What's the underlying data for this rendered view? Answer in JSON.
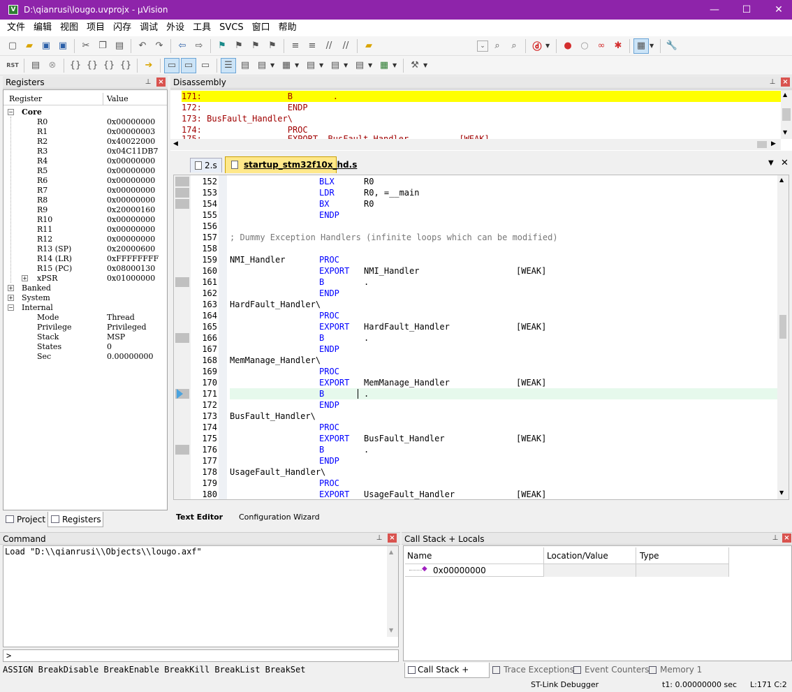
{
  "window": {
    "title": "D:\\qianrusi\\lougo.uvprojx - µVision",
    "minimize": "—",
    "maximize": "☐",
    "close": "✕"
  },
  "menu": [
    "文件",
    "编辑",
    "视图",
    "项目",
    "闪存",
    "调试",
    "外设",
    "工具",
    "SVCS",
    "窗口",
    "帮助"
  ],
  "registers": {
    "title": "Registers",
    "col_register": "Register",
    "col_value": "Value",
    "groups": {
      "core": "Core",
      "banked": "Banked",
      "system": "System",
      "internal": "Internal"
    },
    "core": [
      {
        "name": "R0",
        "value": "0x00000000"
      },
      {
        "name": "R1",
        "value": "0x00000003"
      },
      {
        "name": "R2",
        "value": "0x40022000"
      },
      {
        "name": "R3",
        "value": "0x04C11DB7"
      },
      {
        "name": "R4",
        "value": "0x00000000"
      },
      {
        "name": "R5",
        "value": "0x00000000"
      },
      {
        "name": "R6",
        "value": "0x00000000"
      },
      {
        "name": "R7",
        "value": "0x00000000"
      },
      {
        "name": "R8",
        "value": "0x00000000"
      },
      {
        "name": "R9",
        "value": "0x20000160"
      },
      {
        "name": "R10",
        "value": "0x00000000"
      },
      {
        "name": "R11",
        "value": "0x00000000"
      },
      {
        "name": "R12",
        "value": "0x00000000"
      },
      {
        "name": "R13 (SP)",
        "value": "0x20000600"
      },
      {
        "name": "R14 (LR)",
        "value": "0xFFFFFFFF"
      },
      {
        "name": "R15 (PC)",
        "value": "0x08000130"
      },
      {
        "name": "xPSR",
        "value": "0x01000000"
      }
    ],
    "internal": [
      {
        "name": "Mode",
        "value": "Thread"
      },
      {
        "name": "Privilege",
        "value": "Privileged"
      },
      {
        "name": "Stack",
        "value": "MSP"
      },
      {
        "name": "States",
        "value": "0"
      },
      {
        "name": "Sec",
        "value": "0.00000000"
      }
    ]
  },
  "left_tabs": {
    "project": "Project",
    "registers": "Registers"
  },
  "disassembly": {
    "title": "Disassembly",
    "lines": [
      "171:                 B        .",
      "172:                 ENDP",
      "173: BusFault_Handler\\",
      "174:                 PROC",
      "175:                 EXPORT  BusFault_Handler          [WEAK]"
    ]
  },
  "editor_tabs": {
    "tab1": "2.s",
    "tab2": "startup_stm32f10x_hd.s"
  },
  "editor": {
    "lines": [
      {
        "n": "152",
        "label": "",
        "op": "BLX",
        "arg": "R0",
        "cm": "",
        "c": ""
      },
      {
        "n": "153",
        "label": "",
        "op": "LDR",
        "arg": "R0, =__main",
        "cm": "",
        "c": ""
      },
      {
        "n": "154",
        "label": "",
        "op": "BX",
        "arg": "R0",
        "cm": "",
        "c": ""
      },
      {
        "n": "155",
        "label": "",
        "op": "ENDP",
        "arg": "",
        "cm": "",
        "c": ""
      },
      {
        "n": "156",
        "label": "",
        "op": "",
        "arg": "",
        "cm": "",
        "c": ""
      },
      {
        "n": "157",
        "label": "",
        "op": "",
        "arg": "",
        "cm": "",
        "c": "; Dummy Exception Handlers (infinite loops which can be modified)"
      },
      {
        "n": "158",
        "label": "",
        "op": "",
        "arg": "",
        "cm": "",
        "c": ""
      },
      {
        "n": "159",
        "label": "NMI_Handler",
        "op": "PROC",
        "arg": "",
        "cm": "",
        "c": ""
      },
      {
        "n": "160",
        "label": "",
        "op": "EXPORT",
        "arg": "NMI_Handler",
        "cm": "[WEAK]",
        "c": ""
      },
      {
        "n": "161",
        "label": "",
        "op": "B",
        "arg": ".",
        "cm": "",
        "c": ""
      },
      {
        "n": "162",
        "label": "",
        "op": "ENDP",
        "arg": "",
        "cm": "",
        "c": ""
      },
      {
        "n": "163",
        "label": "HardFault_Handler\\",
        "op": "",
        "arg": "",
        "cm": "",
        "c": ""
      },
      {
        "n": "164",
        "label": "",
        "op": "PROC",
        "arg": "",
        "cm": "",
        "c": ""
      },
      {
        "n": "165",
        "label": "",
        "op": "EXPORT",
        "arg": "HardFault_Handler",
        "cm": "[WEAK]",
        "c": ""
      },
      {
        "n": "166",
        "label": "",
        "op": "B",
        "arg": ".",
        "cm": "",
        "c": ""
      },
      {
        "n": "167",
        "label": "",
        "op": "ENDP",
        "arg": "",
        "cm": "",
        "c": ""
      },
      {
        "n": "168",
        "label": "MemManage_Handler\\",
        "op": "",
        "arg": "",
        "cm": "",
        "c": ""
      },
      {
        "n": "169",
        "label": "",
        "op": "PROC",
        "arg": "",
        "cm": "",
        "c": ""
      },
      {
        "n": "170",
        "label": "",
        "op": "EXPORT",
        "arg": "MemManage_Handler",
        "cm": "[WEAK]",
        "c": ""
      },
      {
        "n": "171",
        "label": "",
        "op": "B",
        "arg": ".",
        "cm": "",
        "c": ""
      },
      {
        "n": "172",
        "label": "",
        "op": "ENDP",
        "arg": "",
        "cm": "",
        "c": ""
      },
      {
        "n": "173",
        "label": "BusFault_Handler\\",
        "op": "",
        "arg": "",
        "cm": "",
        "c": ""
      },
      {
        "n": "174",
        "label": "",
        "op": "PROC",
        "arg": "",
        "cm": "",
        "c": ""
      },
      {
        "n": "175",
        "label": "",
        "op": "EXPORT",
        "arg": "BusFault_Handler",
        "cm": "[WEAK]",
        "c": ""
      },
      {
        "n": "176",
        "label": "",
        "op": "B",
        "arg": ".",
        "cm": "",
        "c": ""
      },
      {
        "n": "177",
        "label": "",
        "op": "ENDP",
        "arg": "",
        "cm": "",
        "c": ""
      },
      {
        "n": "178",
        "label": "UsageFault_Handler\\",
        "op": "",
        "arg": "",
        "cm": "",
        "c": ""
      },
      {
        "n": "179",
        "label": "",
        "op": "PROC",
        "arg": "",
        "cm": "",
        "c": ""
      },
      {
        "n": "180",
        "label": "",
        "op": "EXPORT",
        "arg": "UsageFault_Handler",
        "cm": "[WEAK]",
        "c": ""
      }
    ]
  },
  "editor_bottom_tabs": {
    "text_editor": "Text Editor",
    "config_wizard": "Configuration Wizard"
  },
  "command": {
    "title": "Command",
    "output": "Load \"D:\\\\qianrusi\\\\Objects\\\\lougo.axf\"",
    "prompt": ">",
    "hints": "ASSIGN BreakDisable BreakEnable BreakKill BreakList BreakSet"
  },
  "callstack": {
    "title": "Call Stack + Locals",
    "col_name": "Name",
    "col_location": "Location/Value",
    "col_type": "Type",
    "row_name": "0x00000000",
    "tabs": [
      "Call Stack + Locals",
      "Trace Exceptions",
      "Event Counters",
      "Memory 1"
    ]
  },
  "status": {
    "debugger": "ST-Link Debugger",
    "time": "t1: 0.00000000 sec",
    "pos": "L:171 C:2"
  },
  "colors": {
    "titlebar": "#8e24aa",
    "keyword": "#0000ff",
    "disasm_text": "#a00000",
    "current_line": "#ffff00",
    "exec_line": "#e6f9ec"
  }
}
